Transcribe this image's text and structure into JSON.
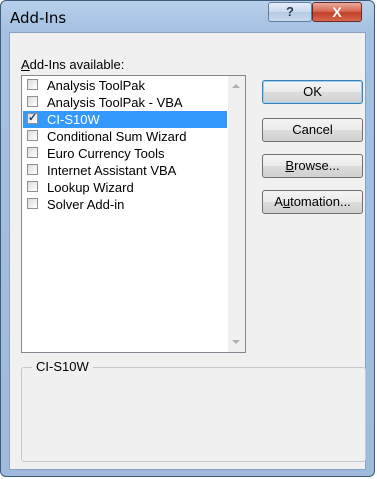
{
  "window": {
    "title": "Add-Ins",
    "help_glyph": "?",
    "close_glyph": "X"
  },
  "list": {
    "label": "Add-Ins available:",
    "items": [
      {
        "label": "Analysis ToolPak",
        "checked": false,
        "selected": false
      },
      {
        "label": "Analysis ToolPak - VBA",
        "checked": false,
        "selected": false
      },
      {
        "label": "CI-S10W",
        "checked": true,
        "selected": true
      },
      {
        "label": "Conditional Sum Wizard",
        "checked": false,
        "selected": false
      },
      {
        "label": "Euro Currency Tools",
        "checked": false,
        "selected": false
      },
      {
        "label": "Internet Assistant VBA",
        "checked": false,
        "selected": false
      },
      {
        "label": "Lookup Wizard",
        "checked": false,
        "selected": false
      },
      {
        "label": "Solver Add-in",
        "checked": false,
        "selected": false
      }
    ]
  },
  "buttons": {
    "ok": "OK",
    "cancel": "Cancel",
    "browse": "Browse...",
    "automation": "Automation..."
  },
  "description": {
    "title": "CI-S10W",
    "text": ""
  },
  "check_glyph": "✓"
}
